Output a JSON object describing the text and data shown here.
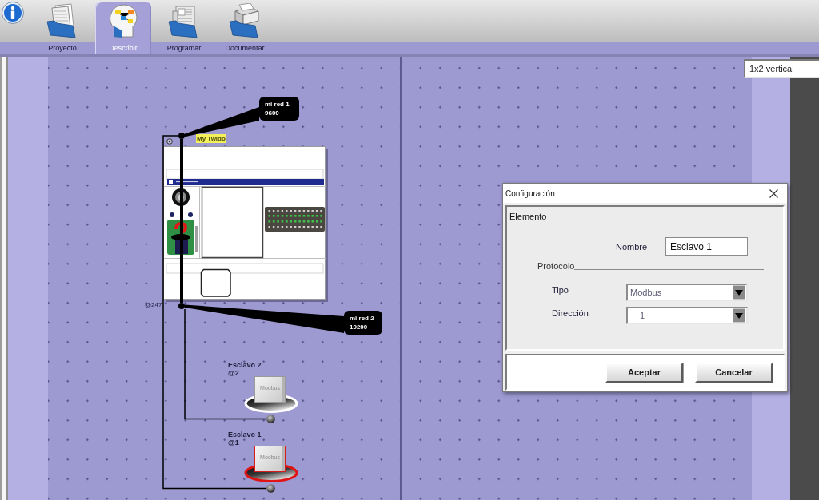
{
  "toolbar": {
    "tabs": [
      {
        "label": "Proyecto",
        "selected": false
      },
      {
        "label": "Describir",
        "selected": true
      },
      {
        "label": "Programar",
        "selected": false
      },
      {
        "label": "Documentar",
        "selected": false
      }
    ]
  },
  "layout_select": {
    "value": "1x2 vertical"
  },
  "diagram": {
    "controller": {
      "label": "My Twido",
      "address": "@247"
    },
    "networks": [
      {
        "name": "mi red 1",
        "speed": "9600"
      },
      {
        "name": "mi red 2",
        "speed": "19200"
      }
    ],
    "slaves": [
      {
        "name": "Esclavo 2",
        "address": "@2",
        "device_label": "Modbus",
        "selected": false
      },
      {
        "name": "Esclavo 1",
        "address": "@1",
        "device_label": "Modbus",
        "selected": true
      }
    ]
  },
  "dialog": {
    "title": "Configuración",
    "sections": [
      {
        "title": "Elemento",
        "fields": [
          {
            "kind": "text",
            "label": "Nombre",
            "value": "Esclavo 1"
          }
        ]
      },
      {
        "title": "Protocolo",
        "fields": [
          {
            "kind": "select",
            "label": "Tipo",
            "value": "Modbus"
          },
          {
            "kind": "select",
            "label": "Dirección",
            "value": "1"
          }
        ]
      }
    ],
    "buttons": [
      "Aceptar",
      "Cancelar"
    ]
  }
}
